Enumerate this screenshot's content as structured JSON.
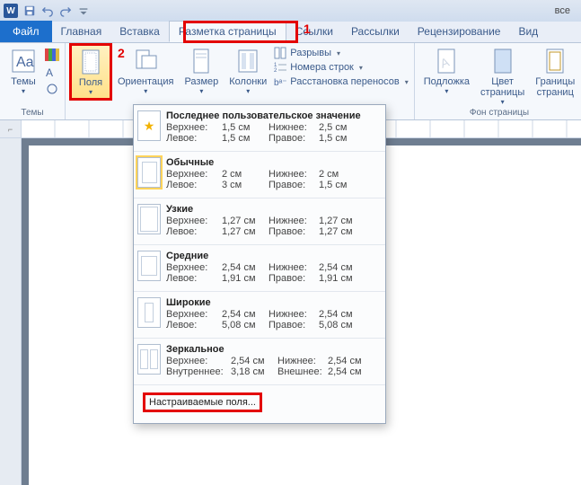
{
  "title_right": "все",
  "tabs": {
    "file": "Файл",
    "home": "Главная",
    "insert": "Вставка",
    "layout": "Разметка страницы",
    "references": "Ссылки",
    "mailings": "Рассылки",
    "review": "Рецензирование",
    "view": "Вид"
  },
  "annotations": {
    "num1": "1",
    "num2": "2"
  },
  "ribbon": {
    "themes": {
      "label": "Темы",
      "button": "Темы"
    },
    "page_setup": {
      "margins": "Поля",
      "orientation": "Ориентация",
      "size": "Размер",
      "columns": "Колонки",
      "breaks": "Разрывы",
      "line_numbers": "Номера строк",
      "hyphenation": "Расстановка переносов"
    },
    "page_bg": {
      "label": "Фон страницы",
      "watermark": "Подложка",
      "page_color": "Цвет\nстраницы",
      "page_borders": "Границы\nстраниц"
    }
  },
  "menu": {
    "last": {
      "title": "Последнее пользовательское значение",
      "top_l": "Верхнее:",
      "top_v": "1,5 см",
      "left_l": "Левое:",
      "left_v": "1,5 см",
      "bot_l": "Нижнее:",
      "bot_v": "2,5 см",
      "right_l": "Правое:",
      "right_v": "1,5 см"
    },
    "normal": {
      "title": "Обычные",
      "top_l": "Верхнее:",
      "top_v": "2 см",
      "left_l": "Левое:",
      "left_v": "3 см",
      "bot_l": "Нижнее:",
      "bot_v": "2 см",
      "right_l": "Правое:",
      "right_v": "1,5 см"
    },
    "narrow": {
      "title": "Узкие",
      "top_l": "Верхнее:",
      "top_v": "1,27 см",
      "left_l": "Левое:",
      "left_v": "1,27 см",
      "bot_l": "Нижнее:",
      "bot_v": "1,27 см",
      "right_l": "Правое:",
      "right_v": "1,27 см"
    },
    "moderate": {
      "title": "Средние",
      "top_l": "Верхнее:",
      "top_v": "2,54 см",
      "left_l": "Левое:",
      "left_v": "1,91 см",
      "bot_l": "Нижнее:",
      "bot_v": "2,54 см",
      "right_l": "Правое:",
      "right_v": "1,91 см"
    },
    "wide": {
      "title": "Широкие",
      "top_l": "Верхнее:",
      "top_v": "2,54 см",
      "left_l": "Левое:",
      "left_v": "5,08 см",
      "bot_l": "Нижнее:",
      "bot_v": "2,54 см",
      "right_l": "Правое:",
      "right_v": "5,08 см"
    },
    "mirrored": {
      "title": "Зеркальное",
      "top_l": "Верхнее:",
      "top_v": "2,54 см",
      "left_l": "Внутреннее:",
      "left_v": "3,18 см",
      "bot_l": "Нижнее:",
      "bot_v": "2,54 см",
      "right_l": "Внешнее:",
      "right_v": "2,54 см"
    },
    "custom": "Настраиваемые поля..."
  }
}
